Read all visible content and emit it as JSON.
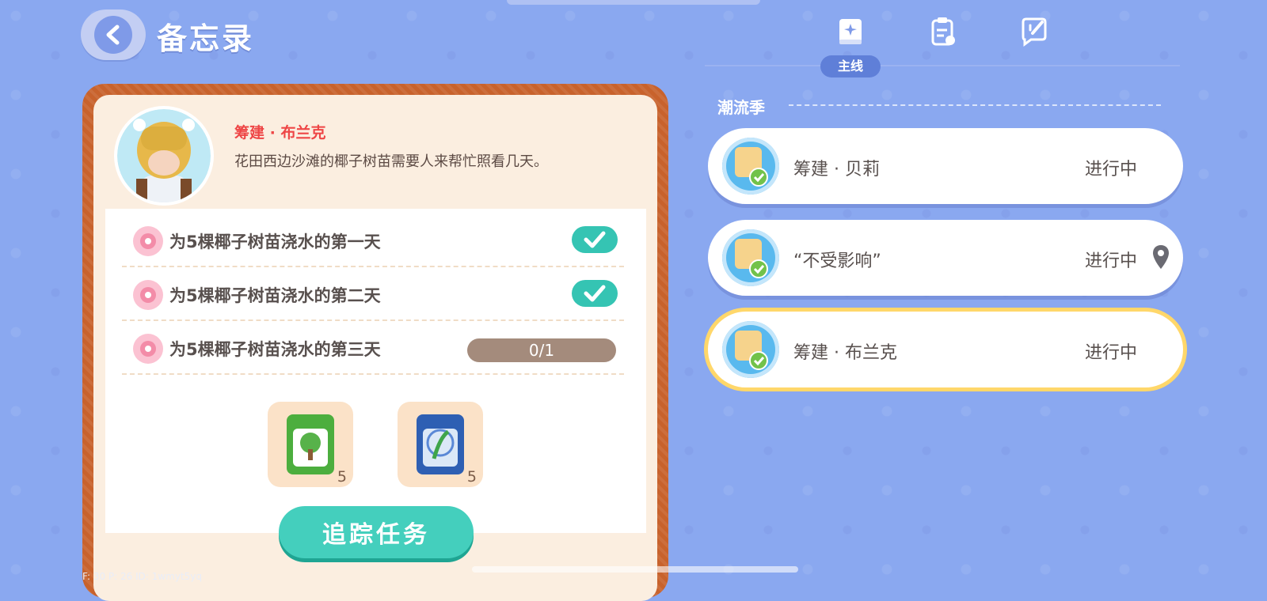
{
  "header": {
    "title": "备忘录"
  },
  "npc": {
    "name": "筹建 · 布兰克",
    "description": "花田西边沙滩的椰子树苗需要人来帮忙照看几天。"
  },
  "tasks": [
    {
      "text": "为5棵椰子树苗浇水的第一天",
      "done": true
    },
    {
      "text": "为5棵椰子树苗浇水的第二天",
      "done": true
    },
    {
      "text": "为5棵椰子树苗浇水的第三天",
      "done": false,
      "progress": "0/1"
    }
  ],
  "rewards": [
    {
      "icon": "tree-seed-bag-icon",
      "count": "5"
    },
    {
      "icon": "fast-grow-seed-bag-icon",
      "count": "5"
    }
  ],
  "track_button": "追踪任务",
  "tabs": {
    "active_label": "主线",
    "icons": [
      "main-quest-book-icon",
      "clipboard-icon",
      "note-edit-icon"
    ]
  },
  "section": {
    "title": "潮流季"
  },
  "quests": [
    {
      "name": "筹建 · 贝莉",
      "status": "进行中",
      "selected": false
    },
    {
      "name": "“不受影响”",
      "status": "进行中",
      "selected": false,
      "has_pin": true
    },
    {
      "name": "筹建 · 布兰克",
      "status": "进行中",
      "selected": true
    }
  ],
  "debug": "F: 30   P: 26   ID: 1wmyt5yq",
  "colors": {
    "background": "#8aa8f0",
    "accent_teal": "#44cfbd",
    "name_red": "#ee4646",
    "card_border": "#c8622c",
    "selected_outline": "#ffd76a"
  }
}
